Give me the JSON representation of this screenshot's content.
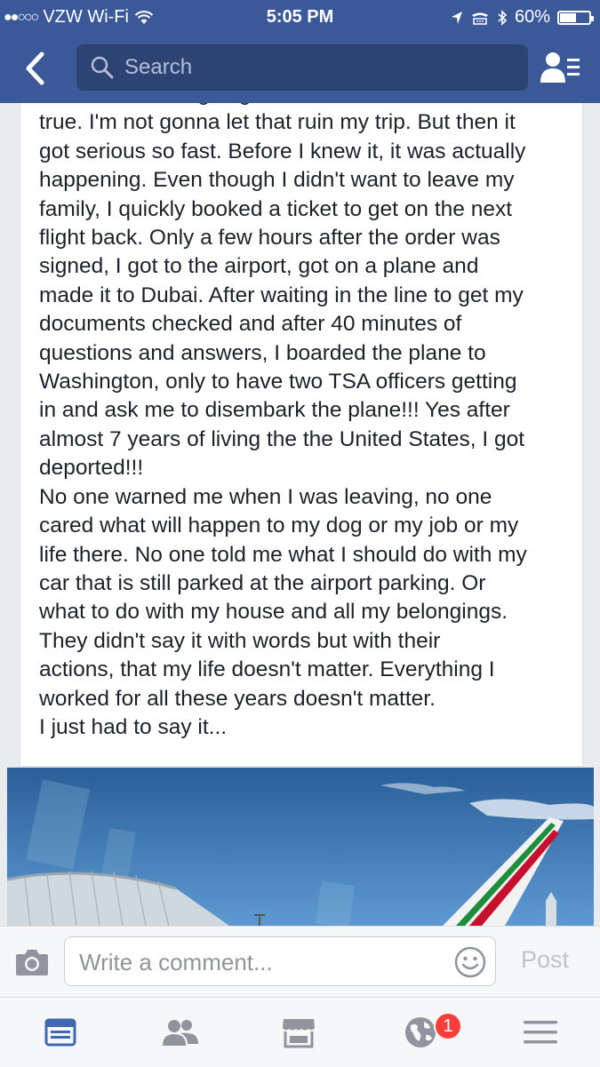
{
  "status_bar": {
    "carrier": "VZW Wi-Fi",
    "time": "5:05 PM",
    "battery_text": "60%",
    "battery_level": 0.6
  },
  "search": {
    "placeholder": "Search"
  },
  "post": {
    "text": "be banned from going back!!!! No that can't be\ntrue. I'm not gonna let that ruin my trip. But then it\ngot serious so fast. Before I knew it, it was actually\nhappening. Even though I didn't want to leave my\nfamily, I quickly booked a ticket to get on the next\nflight back. Only a few hours after the order was\nsigned, I got to the airport, got on a plane and\nmade it to Dubai. After waiting in the line to get my\ndocuments checked and after 40 minutes of\nquestions and answers, I boarded the plane to\nWashington, only to have two TSA officers getting\nin and ask me to disembark the plane!!! Yes after\nalmost 7 years of living the the United States, I got\ndeported!!!\nNo one warned me when I was leaving, no one\ncared what will happen to my dog or my job or my\nlife there. No one told me what I should do with my\ncar that is still parked at the airport parking. Or\nwhat to do with my house and all my belongings.\nThey didn't say it with words but with their\nactions, that my life doesn't matter. Everything I\nworked for all these years doesn't matter.\nI just had to say it..."
  },
  "comment": {
    "placeholder": "Write a comment...",
    "post_label": "Post"
  },
  "tabbar": {
    "notifications_badge": "1"
  },
  "colors": {
    "header_blue": "#3b5998",
    "search_field": "#2d4373",
    "active_tab": "#4267b2",
    "inactive_tab": "#90949c",
    "badge_red": "#fa3e3e"
  }
}
